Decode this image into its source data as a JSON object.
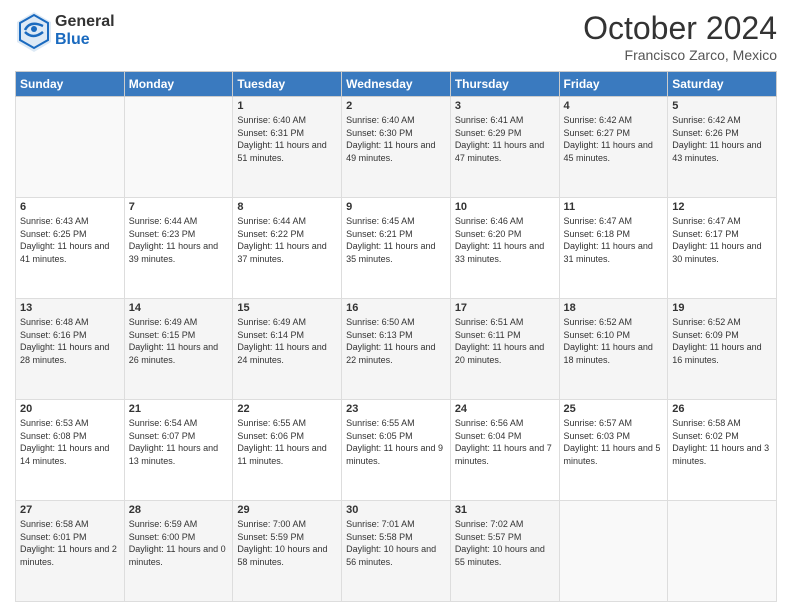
{
  "header": {
    "logo": {
      "line1": "General",
      "line2": "Blue"
    },
    "title": "October 2024",
    "subtitle": "Francisco Zarco, Mexico"
  },
  "weekdays": [
    "Sunday",
    "Monday",
    "Tuesday",
    "Wednesday",
    "Thursday",
    "Friday",
    "Saturday"
  ],
  "weeks": [
    [
      {
        "day": "",
        "info": ""
      },
      {
        "day": "",
        "info": ""
      },
      {
        "day": "1",
        "info": "Sunrise: 6:40 AM\nSunset: 6:31 PM\nDaylight: 11 hours and 51 minutes."
      },
      {
        "day": "2",
        "info": "Sunrise: 6:40 AM\nSunset: 6:30 PM\nDaylight: 11 hours and 49 minutes."
      },
      {
        "day": "3",
        "info": "Sunrise: 6:41 AM\nSunset: 6:29 PM\nDaylight: 11 hours and 47 minutes."
      },
      {
        "day": "4",
        "info": "Sunrise: 6:42 AM\nSunset: 6:27 PM\nDaylight: 11 hours and 45 minutes."
      },
      {
        "day": "5",
        "info": "Sunrise: 6:42 AM\nSunset: 6:26 PM\nDaylight: 11 hours and 43 minutes."
      }
    ],
    [
      {
        "day": "6",
        "info": "Sunrise: 6:43 AM\nSunset: 6:25 PM\nDaylight: 11 hours and 41 minutes."
      },
      {
        "day": "7",
        "info": "Sunrise: 6:44 AM\nSunset: 6:23 PM\nDaylight: 11 hours and 39 minutes."
      },
      {
        "day": "8",
        "info": "Sunrise: 6:44 AM\nSunset: 6:22 PM\nDaylight: 11 hours and 37 minutes."
      },
      {
        "day": "9",
        "info": "Sunrise: 6:45 AM\nSunset: 6:21 PM\nDaylight: 11 hours and 35 minutes."
      },
      {
        "day": "10",
        "info": "Sunrise: 6:46 AM\nSunset: 6:20 PM\nDaylight: 11 hours and 33 minutes."
      },
      {
        "day": "11",
        "info": "Sunrise: 6:47 AM\nSunset: 6:18 PM\nDaylight: 11 hours and 31 minutes."
      },
      {
        "day": "12",
        "info": "Sunrise: 6:47 AM\nSunset: 6:17 PM\nDaylight: 11 hours and 30 minutes."
      }
    ],
    [
      {
        "day": "13",
        "info": "Sunrise: 6:48 AM\nSunset: 6:16 PM\nDaylight: 11 hours and 28 minutes."
      },
      {
        "day": "14",
        "info": "Sunrise: 6:49 AM\nSunset: 6:15 PM\nDaylight: 11 hours and 26 minutes."
      },
      {
        "day": "15",
        "info": "Sunrise: 6:49 AM\nSunset: 6:14 PM\nDaylight: 11 hours and 24 minutes."
      },
      {
        "day": "16",
        "info": "Sunrise: 6:50 AM\nSunset: 6:13 PM\nDaylight: 11 hours and 22 minutes."
      },
      {
        "day": "17",
        "info": "Sunrise: 6:51 AM\nSunset: 6:11 PM\nDaylight: 11 hours and 20 minutes."
      },
      {
        "day": "18",
        "info": "Sunrise: 6:52 AM\nSunset: 6:10 PM\nDaylight: 11 hours and 18 minutes."
      },
      {
        "day": "19",
        "info": "Sunrise: 6:52 AM\nSunset: 6:09 PM\nDaylight: 11 hours and 16 minutes."
      }
    ],
    [
      {
        "day": "20",
        "info": "Sunrise: 6:53 AM\nSunset: 6:08 PM\nDaylight: 11 hours and 14 minutes."
      },
      {
        "day": "21",
        "info": "Sunrise: 6:54 AM\nSunset: 6:07 PM\nDaylight: 11 hours and 13 minutes."
      },
      {
        "day": "22",
        "info": "Sunrise: 6:55 AM\nSunset: 6:06 PM\nDaylight: 11 hours and 11 minutes."
      },
      {
        "day": "23",
        "info": "Sunrise: 6:55 AM\nSunset: 6:05 PM\nDaylight: 11 hours and 9 minutes."
      },
      {
        "day": "24",
        "info": "Sunrise: 6:56 AM\nSunset: 6:04 PM\nDaylight: 11 hours and 7 minutes."
      },
      {
        "day": "25",
        "info": "Sunrise: 6:57 AM\nSunset: 6:03 PM\nDaylight: 11 hours and 5 minutes."
      },
      {
        "day": "26",
        "info": "Sunrise: 6:58 AM\nSunset: 6:02 PM\nDaylight: 11 hours and 3 minutes."
      }
    ],
    [
      {
        "day": "27",
        "info": "Sunrise: 6:58 AM\nSunset: 6:01 PM\nDaylight: 11 hours and 2 minutes."
      },
      {
        "day": "28",
        "info": "Sunrise: 6:59 AM\nSunset: 6:00 PM\nDaylight: 11 hours and 0 minutes."
      },
      {
        "day": "29",
        "info": "Sunrise: 7:00 AM\nSunset: 5:59 PM\nDaylight: 10 hours and 58 minutes."
      },
      {
        "day": "30",
        "info": "Sunrise: 7:01 AM\nSunset: 5:58 PM\nDaylight: 10 hours and 56 minutes."
      },
      {
        "day": "31",
        "info": "Sunrise: 7:02 AM\nSunset: 5:57 PM\nDaylight: 10 hours and 55 minutes."
      },
      {
        "day": "",
        "info": ""
      },
      {
        "day": "",
        "info": ""
      }
    ]
  ]
}
